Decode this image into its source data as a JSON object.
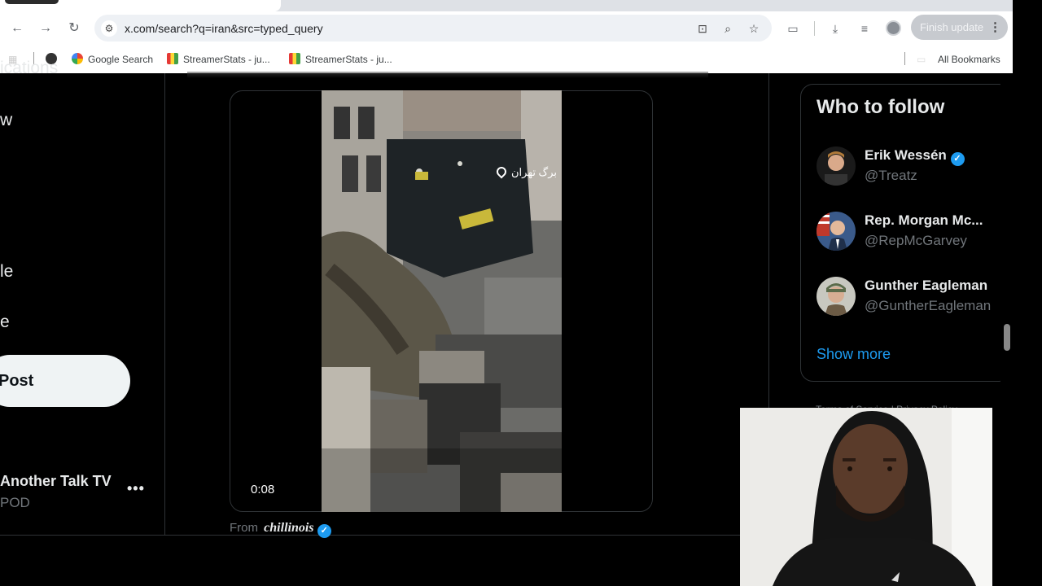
{
  "browser": {
    "url": "x.com/search?q=iran&src=typed_query",
    "finish_update_label": "Finish update",
    "bookmarks": [
      {
        "label": "Google Search"
      },
      {
        "label": "StreamerStats - ju..."
      },
      {
        "label": "StreamerStats - ju..."
      }
    ],
    "all_bookmarks_label": "All Bookmarks"
  },
  "left_nav": {
    "fragments": [
      "ications",
      "w",
      "le",
      "e"
    ],
    "post_label": "Post",
    "account_name": "Another Talk TV",
    "account_handle": "POD",
    "more_label": "•••"
  },
  "video": {
    "time": "0:08",
    "location_tag": "برگ تهران",
    "from_prefix": "From",
    "source": "chillinois"
  },
  "who_to_follow": {
    "title": "Who to follow",
    "accounts": [
      {
        "name": "Erik Wessén",
        "handle": "@Treatz",
        "verified": true
      },
      {
        "name": "Rep. Morgan Mc...",
        "handle": "@RepMcGarvey",
        "verified": false
      },
      {
        "name": "Gunther Eagleman",
        "handle": "@GuntherEagleman",
        "verified": false
      }
    ],
    "show_more": "Show more"
  },
  "footer_fragment": "Terms of Service | Privacy Policy",
  "colors": {
    "accent": "#1d9bf0",
    "background": "#000000",
    "text_primary": "#e7e9ea",
    "text_secondary": "#71767b"
  }
}
